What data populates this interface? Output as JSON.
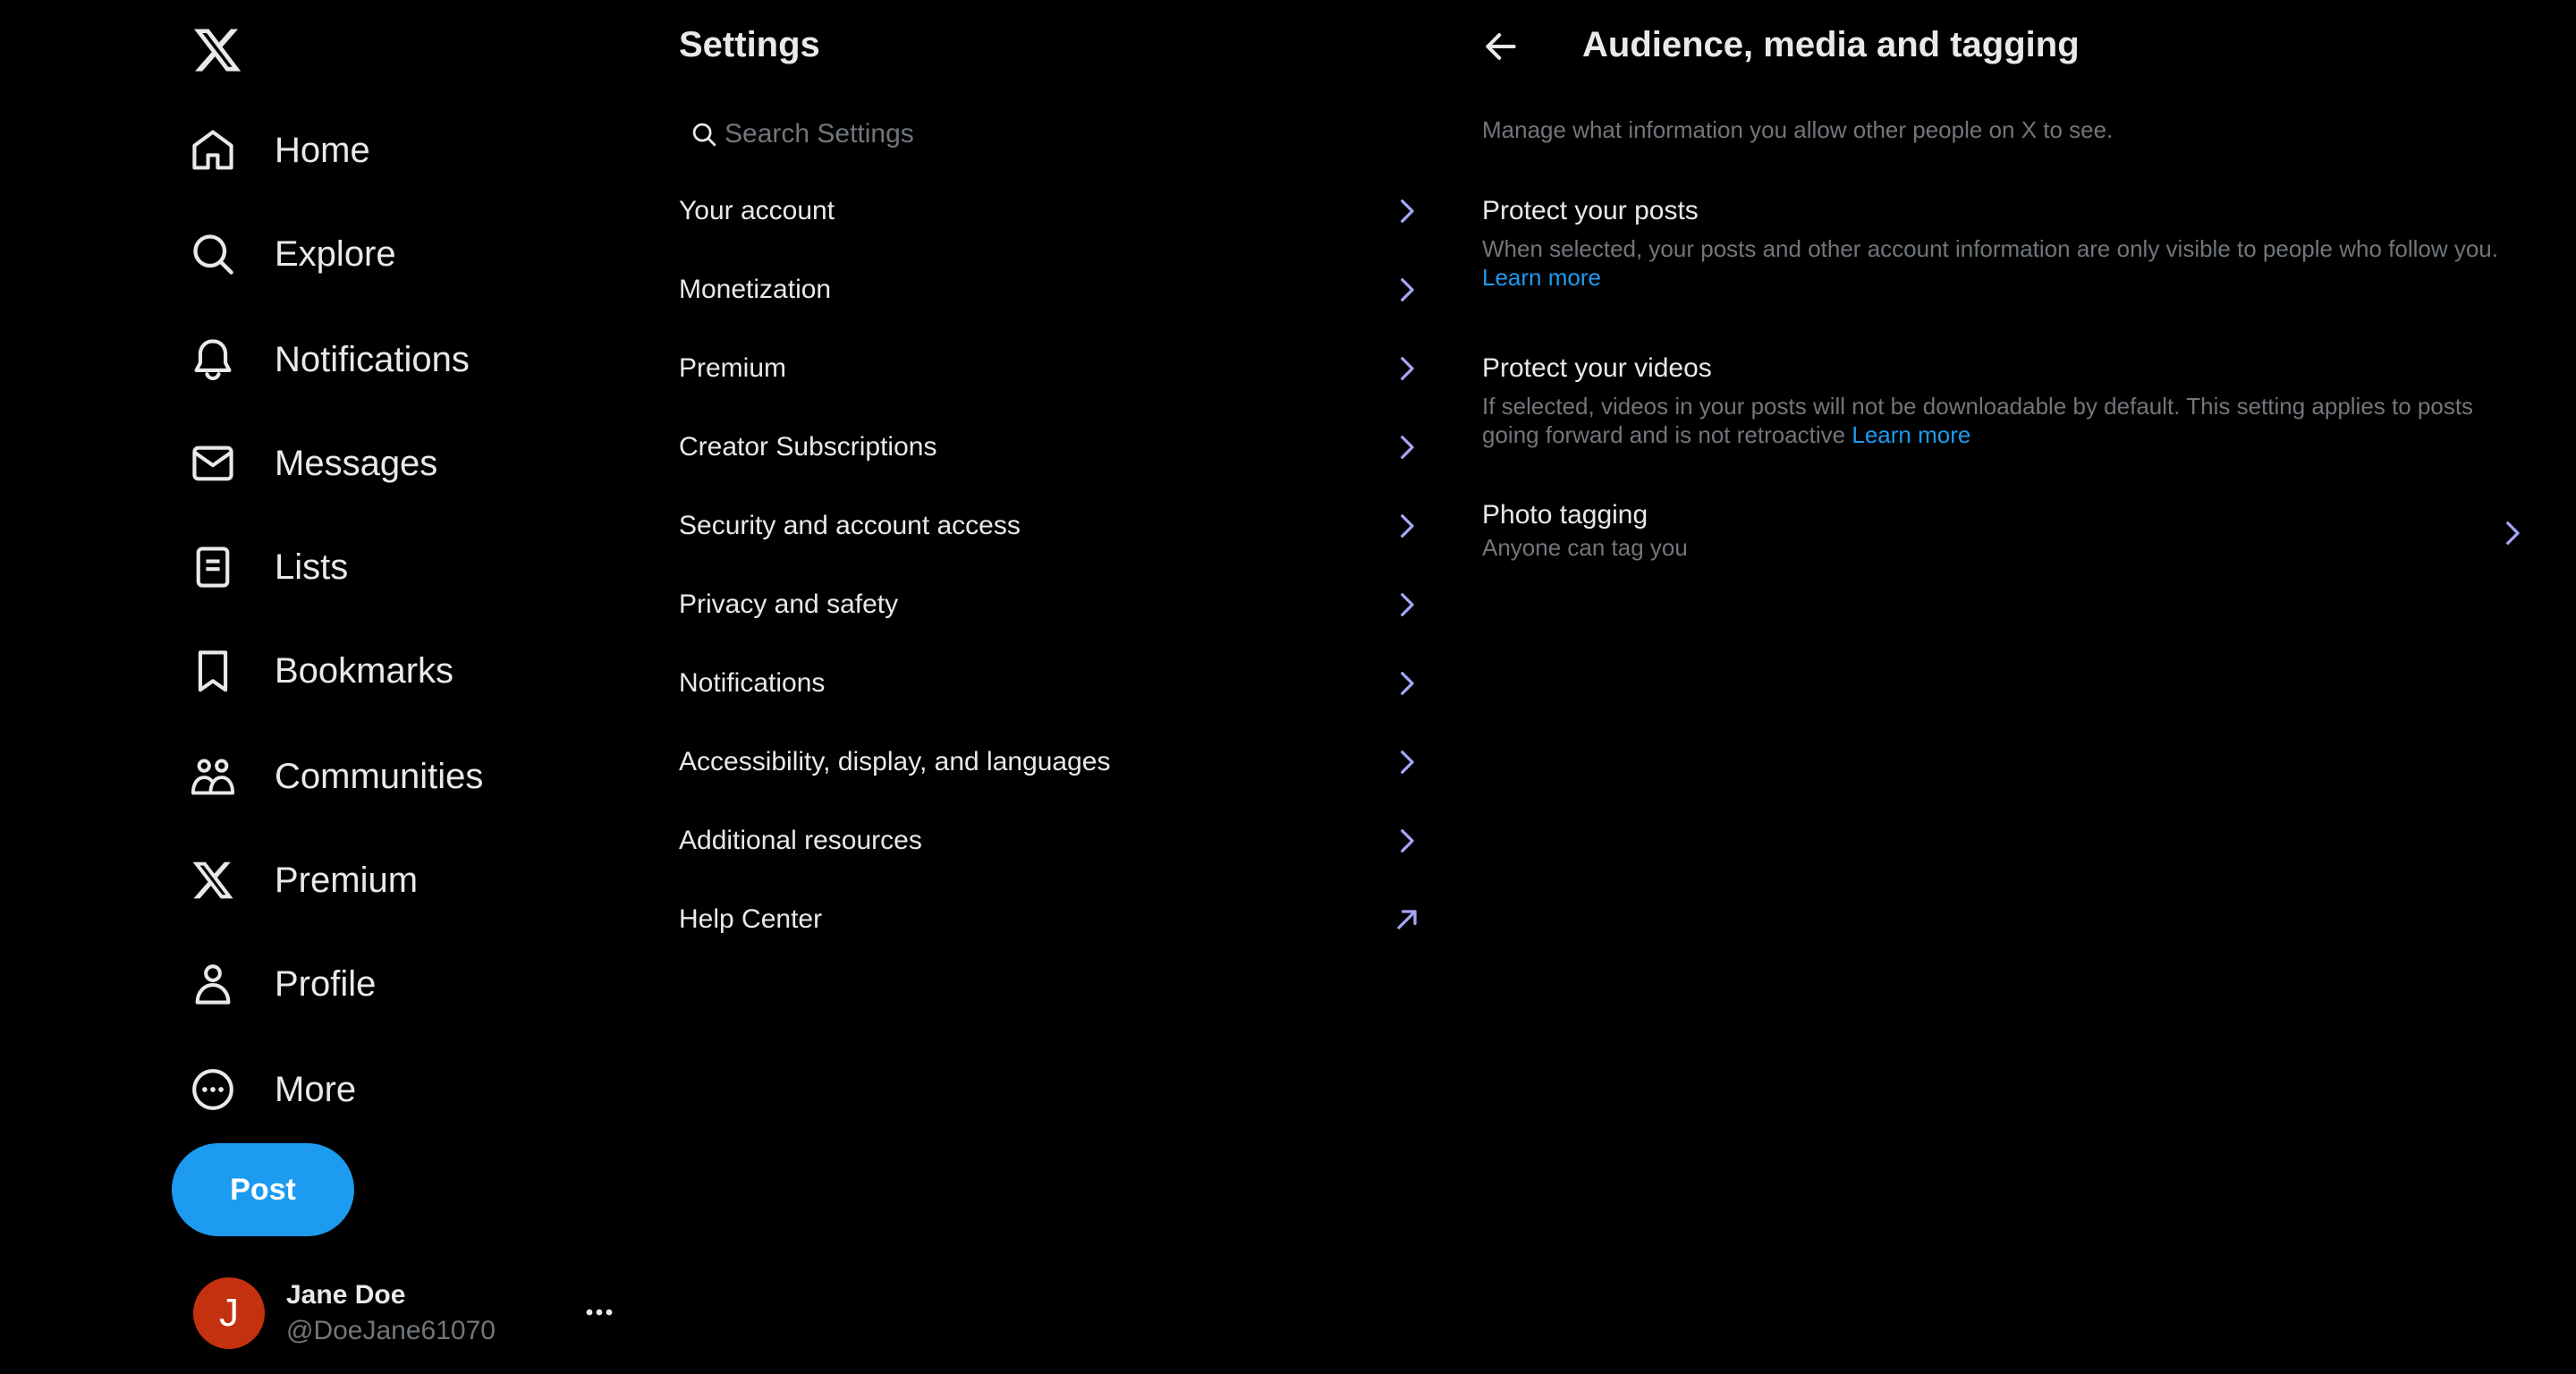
{
  "nav": {
    "logo": "x-logo-icon",
    "items": [
      {
        "label": "Home",
        "icon": "home-icon"
      },
      {
        "label": "Explore",
        "icon": "search-icon"
      },
      {
        "label": "Notifications",
        "icon": "bell-icon"
      },
      {
        "label": "Messages",
        "icon": "envelope-icon"
      },
      {
        "label": "Lists",
        "icon": "list-icon"
      },
      {
        "label": "Bookmarks",
        "icon": "bookmark-icon"
      },
      {
        "label": "Communities",
        "icon": "communities-icon"
      },
      {
        "label": "Premium",
        "icon": "x-logo-icon"
      },
      {
        "label": "Profile",
        "icon": "person-icon"
      },
      {
        "label": "More",
        "icon": "more-circle-icon"
      }
    ],
    "post_label": "Post",
    "account": {
      "initial": "J",
      "name": "Jane Doe",
      "handle": "@DoeJane61070"
    }
  },
  "settings": {
    "title": "Settings",
    "search_placeholder": "Search Settings",
    "items": [
      {
        "label": "Your account",
        "icon": "chevron-right-icon"
      },
      {
        "label": "Monetization",
        "icon": "chevron-right-icon"
      },
      {
        "label": "Premium",
        "icon": "chevron-right-icon"
      },
      {
        "label": "Creator Subscriptions",
        "icon": "chevron-right-icon"
      },
      {
        "label": "Security and account access",
        "icon": "chevron-right-icon"
      },
      {
        "label": "Privacy and safety",
        "icon": "chevron-right-icon"
      },
      {
        "label": "Notifications",
        "icon": "chevron-right-icon"
      },
      {
        "label": "Accessibility, display, and languages",
        "icon": "chevron-right-icon"
      },
      {
        "label": "Additional resources",
        "icon": "chevron-right-icon"
      },
      {
        "label": "Help Center",
        "icon": "external-link-icon"
      }
    ]
  },
  "detail": {
    "title": "Audience, media and tagging",
    "description": "Manage what information you allow other people on X to see.",
    "protect_posts": {
      "title": "Protect your posts",
      "desc": "When selected, your posts and other account information are only visible to people who follow you.",
      "link": "Learn more"
    },
    "protect_videos": {
      "title": "Protect your videos",
      "desc": "If selected, videos in your posts will not be downloadable by default. This setting applies to posts going forward and is not retroactive",
      "link": "Learn more"
    },
    "photo_tagging": {
      "title": "Photo tagging",
      "subtitle": "Anyone can tag you"
    }
  },
  "colors": {
    "background": "#000000",
    "text": "#e7e9ea",
    "secondary_text": "#71767b",
    "accent": "#1d9bf0",
    "chevron": "#a5a6f6",
    "avatar": "#c4310f"
  }
}
